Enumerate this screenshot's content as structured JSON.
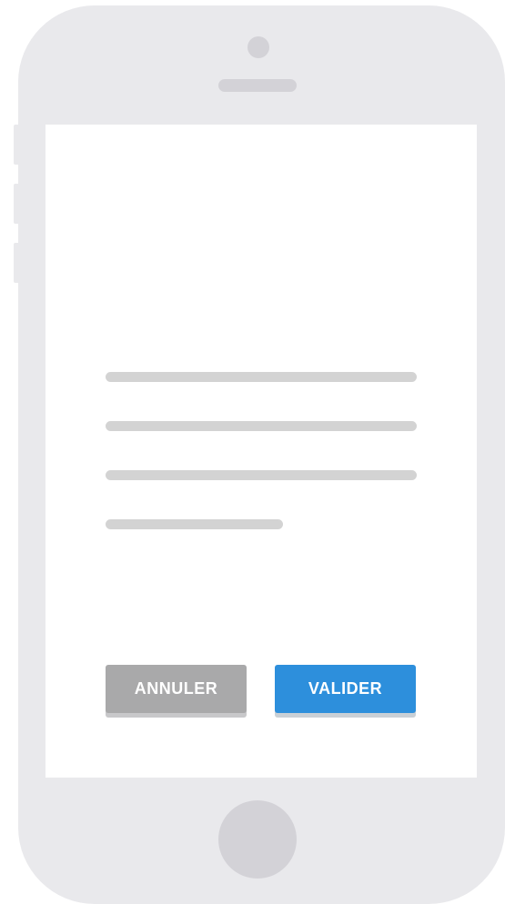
{
  "dialog": {
    "cancel_label": "ANNULER",
    "validate_label": "VALIDER"
  },
  "colors": {
    "phone_body": "#e9e9ec",
    "phone_details": "#d3d2d7",
    "screen": "#ffffff",
    "text_placeholder": "#d3d3d3",
    "cancel_button": "#a9a9aa",
    "validate_button": "#2d8fdc"
  }
}
